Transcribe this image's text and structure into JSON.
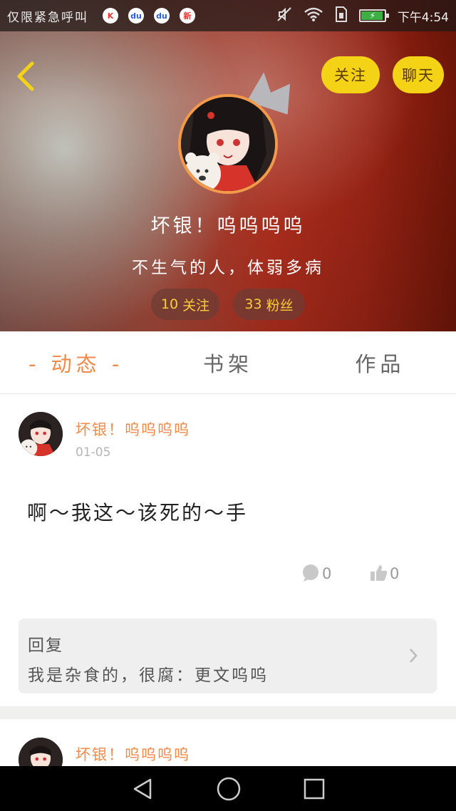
{
  "status_bar": {
    "carrier": "仅限紧急呼叫",
    "apps": [
      {
        "name": "app-k-icon",
        "glyph": "K",
        "color": "#e33"
      },
      {
        "name": "app-du-icon",
        "glyph": "du",
        "color": "#2a5bd7"
      },
      {
        "name": "app-du2-icon",
        "glyph": "du",
        "color": "#2a5bd7"
      },
      {
        "name": "app-news-icon",
        "glyph": "新",
        "color": "#e33"
      }
    ],
    "time": "下午4:54"
  },
  "header": {
    "follow_label": "关注",
    "chat_label": "聊天",
    "username": "坏银！呜呜呜呜",
    "bio": "不生气的人，体弱多病",
    "stats": {
      "following_count": "10",
      "following_label": "关注",
      "fans_count": "33",
      "fans_label": "粉丝"
    }
  },
  "tabs": [
    {
      "label": "- 动态 -",
      "active": true
    },
    {
      "label": "书架",
      "active": false
    },
    {
      "label": "作品",
      "active": false
    }
  ],
  "posts": [
    {
      "author": "坏银！呜呜呜呜",
      "date": "01-05",
      "text": "啊～我这～该死的～手",
      "comments": "0",
      "likes": "0",
      "reply": {
        "title": "回复",
        "text": "我是杂食的，很腐：更文呜呜"
      }
    },
    {
      "author": "坏银！呜呜呜呜"
    }
  ],
  "colors": {
    "accent": "#f08a4b",
    "button_yellow": "#f4d215",
    "stat_text": "#f6cf3a"
  }
}
